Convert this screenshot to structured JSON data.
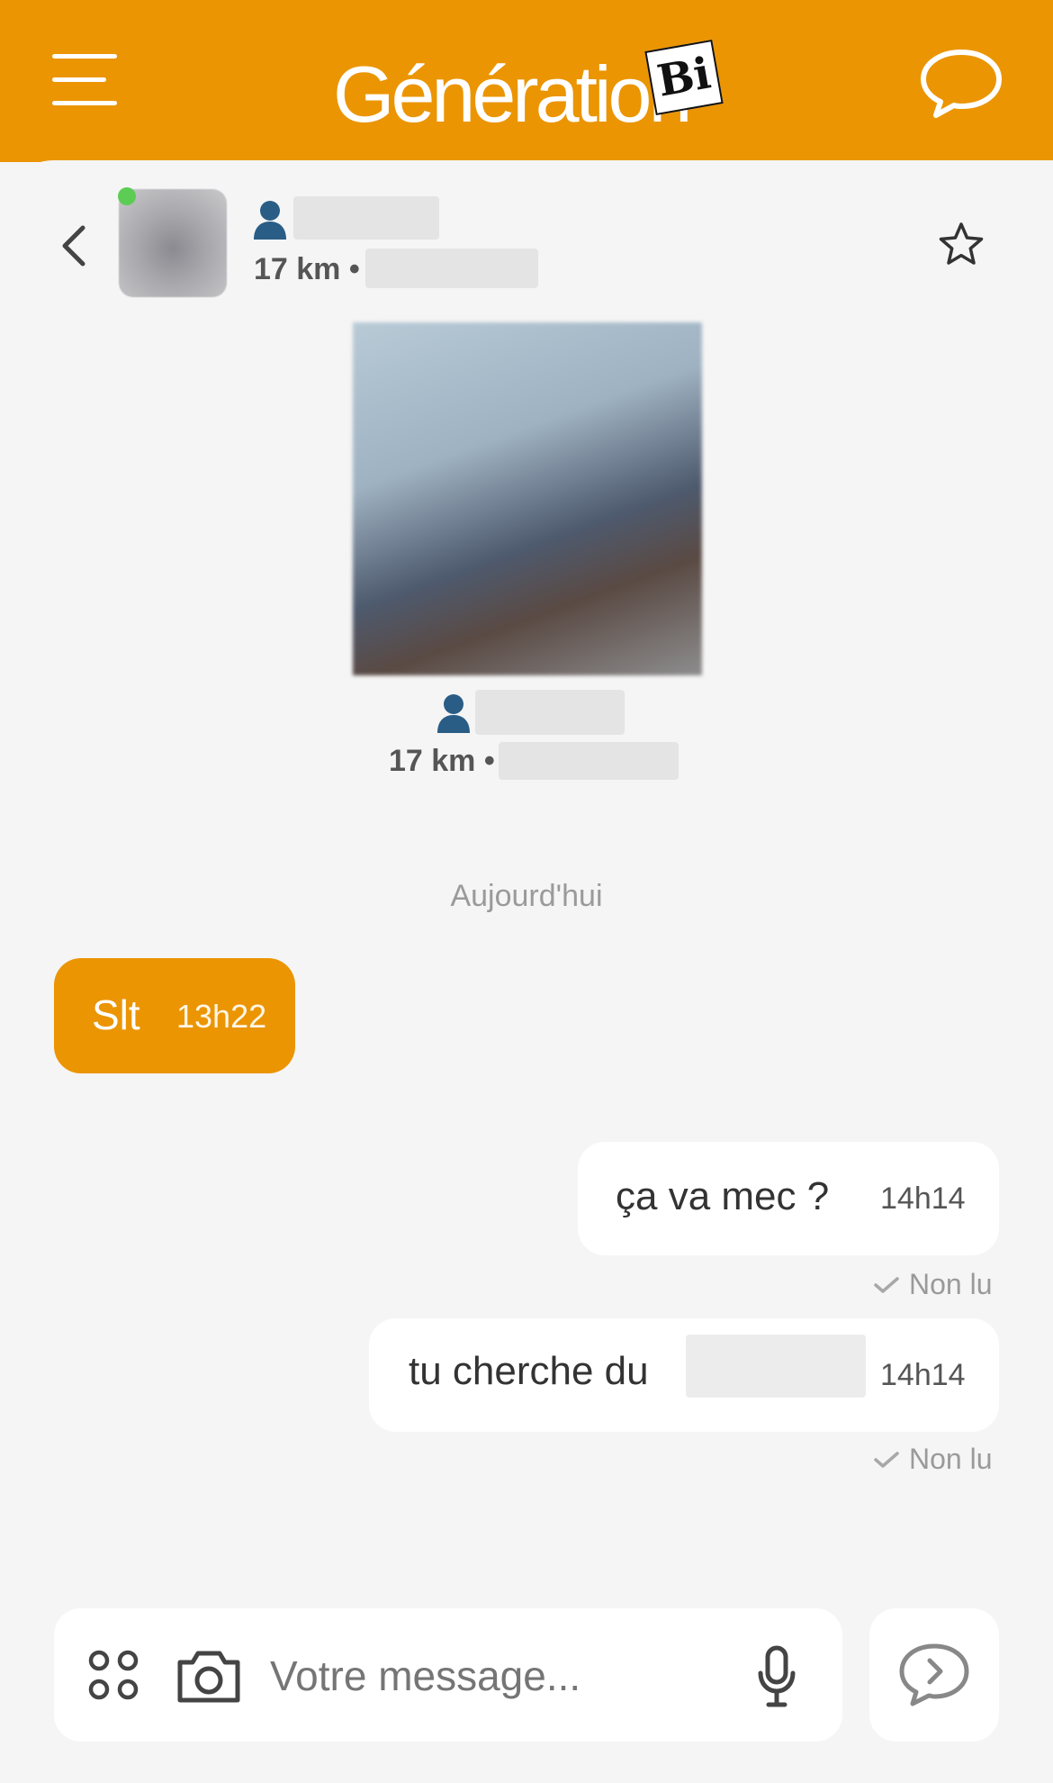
{
  "header": {
    "logo_text": "Génération",
    "logo_badge": "Bi",
    "brand_color": "#eb9503"
  },
  "profile": {
    "distance_label": "17 km •",
    "online": true
  },
  "profile_card": {
    "distance_label": "17 km •"
  },
  "conversation": {
    "day_separator": "Aujourd'hui",
    "messages": [
      {
        "direction": "in",
        "text": "Slt",
        "time": "13h22"
      },
      {
        "direction": "out",
        "text": "ça va mec ?",
        "time": "14h14",
        "status": "Non lu"
      },
      {
        "direction": "out",
        "text": "tu cherche du",
        "time": "14h14",
        "status": "Non lu"
      }
    ]
  },
  "composer": {
    "placeholder": "Votre message..."
  },
  "icons": {
    "menu": "hamburger-icon",
    "chat": "chat-bubble-icon",
    "back": "chevron-left-icon",
    "favorite": "star-icon",
    "user": "user-icon",
    "apps": "apps-grid-icon",
    "camera": "camera-icon",
    "mic": "microphone-icon",
    "send": "send-bubble-icon",
    "check": "check-icon"
  }
}
